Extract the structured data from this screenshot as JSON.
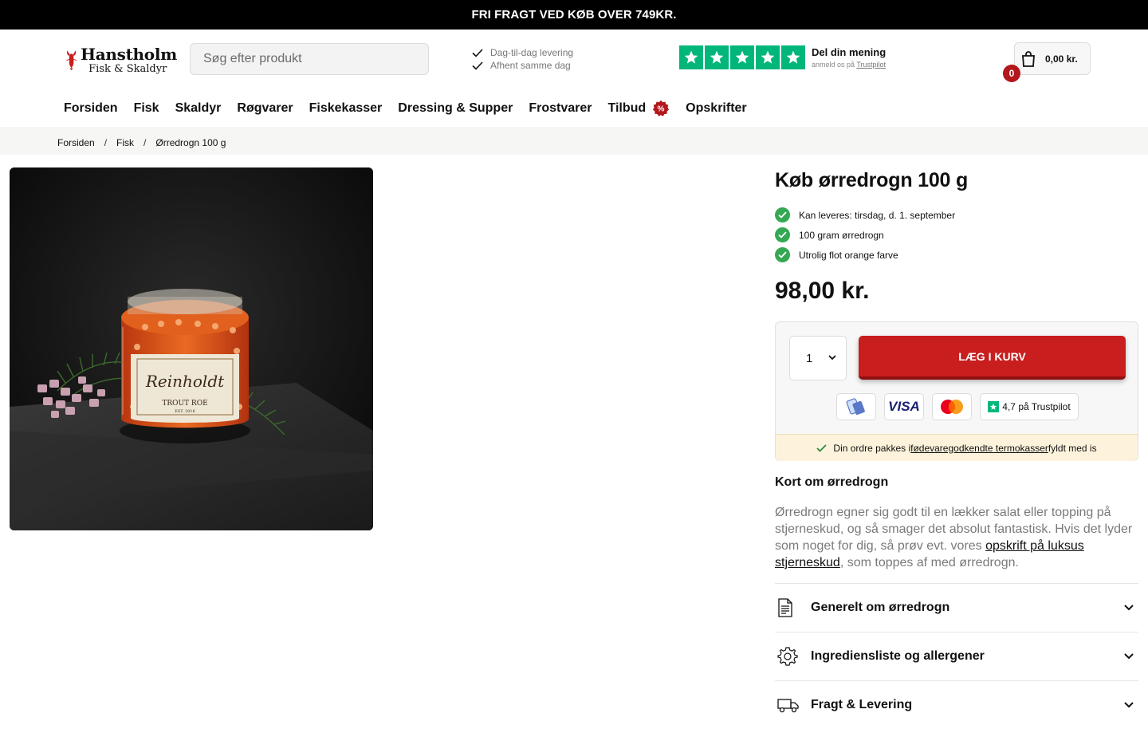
{
  "topbar": {
    "text": "FRI FRAGT VED KØB OVER 749KR."
  },
  "header": {
    "logo_line1": "Hanstholm",
    "logo_line2": "Fisk & Skaldyr",
    "search_placeholder": "Søg efter produkt",
    "usp": [
      "Dag-til-dag levering",
      "Afhent samme dag"
    ],
    "trustpilot": {
      "title": "Del din mening",
      "sub_prefix": "anmeld os på ",
      "sub_link": "Trustpilot",
      "star_color": "#00b67a"
    },
    "cart": {
      "count": "0",
      "amount": "0,00 kr."
    }
  },
  "nav": [
    "Forsiden",
    "Fisk",
    "Skaldyr",
    "Røgvarer",
    "Fiskekasser",
    "Dressing & Supper",
    "Frostvarer",
    "Tilbud",
    "Opskrifter"
  ],
  "breadcrumb": [
    "Forsiden",
    "Fisk",
    "Ørredrogn 100 g"
  ],
  "product": {
    "title": "Køb ørredrogn 100 g",
    "features": [
      "Kan leveres: tirsdag, d. 1. september",
      "100 gram ørredrogn",
      "Utrolig flot orange farve"
    ],
    "price": "98,00 kr.",
    "quantity": "1",
    "add_to_cart": "LÆG I KURV",
    "payments": [
      "mobilepay-icon",
      "visa-icon",
      "mastercard-icon"
    ],
    "visa_label": "VISA",
    "trustpilot_rating": "4,7 på Trustpilot",
    "notice": {
      "pre": "Din ordre pakkes i ",
      "link": "fødevaregodkendte termokasser",
      "post": " fyldt med is"
    },
    "image": {
      "jar_label_brand": "Reinholdt",
      "jar_label_sub": "TROUT ROE",
      "jar_label_est": "EST. 2016"
    }
  },
  "about": {
    "heading": "Kort om ørredrogn",
    "text_pre": "Ørredrogn egner sig godt til en lækker salat eller topping på stjerneskud, og så smager det absolut fantastisk. Hvis det lyder som noget for dig, så prøv evt. vores ",
    "link": "opskrift på luksus stjerneskud",
    "text_post": ", som toppes af med ørredrogn."
  },
  "accordions": [
    {
      "label": "Generelt om ørredrogn",
      "icon": "document-icon"
    },
    {
      "label": "Ingrediensliste og allergener",
      "icon": "gear-icon"
    },
    {
      "label": "Fragt & Levering",
      "icon": "truck-icon"
    }
  ],
  "colors": {
    "brand_red": "#c81e1e",
    "badge_red": "#b3161b",
    "check_green": "#34a853",
    "trustpilot_green": "#00b67a"
  }
}
